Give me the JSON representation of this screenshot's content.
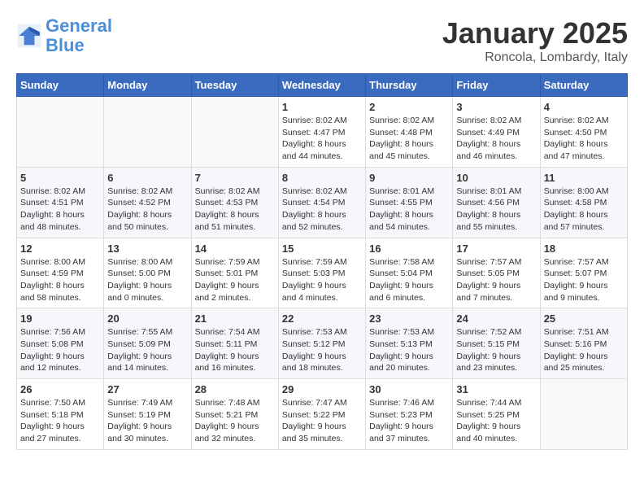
{
  "header": {
    "logo_general": "General",
    "logo_blue": "Blue",
    "month": "January 2025",
    "location": "Roncola, Lombardy, Italy"
  },
  "weekdays": [
    "Sunday",
    "Monday",
    "Tuesday",
    "Wednesday",
    "Thursday",
    "Friday",
    "Saturday"
  ],
  "weeks": [
    [
      {
        "day": "",
        "detail": ""
      },
      {
        "day": "",
        "detail": ""
      },
      {
        "day": "",
        "detail": ""
      },
      {
        "day": "1",
        "detail": "Sunrise: 8:02 AM\nSunset: 4:47 PM\nDaylight: 8 hours\nand 44 minutes."
      },
      {
        "day": "2",
        "detail": "Sunrise: 8:02 AM\nSunset: 4:48 PM\nDaylight: 8 hours\nand 45 minutes."
      },
      {
        "day": "3",
        "detail": "Sunrise: 8:02 AM\nSunset: 4:49 PM\nDaylight: 8 hours\nand 46 minutes."
      },
      {
        "day": "4",
        "detail": "Sunrise: 8:02 AM\nSunset: 4:50 PM\nDaylight: 8 hours\nand 47 minutes."
      }
    ],
    [
      {
        "day": "5",
        "detail": "Sunrise: 8:02 AM\nSunset: 4:51 PM\nDaylight: 8 hours\nand 48 minutes."
      },
      {
        "day": "6",
        "detail": "Sunrise: 8:02 AM\nSunset: 4:52 PM\nDaylight: 8 hours\nand 50 minutes."
      },
      {
        "day": "7",
        "detail": "Sunrise: 8:02 AM\nSunset: 4:53 PM\nDaylight: 8 hours\nand 51 minutes."
      },
      {
        "day": "8",
        "detail": "Sunrise: 8:02 AM\nSunset: 4:54 PM\nDaylight: 8 hours\nand 52 minutes."
      },
      {
        "day": "9",
        "detail": "Sunrise: 8:01 AM\nSunset: 4:55 PM\nDaylight: 8 hours\nand 54 minutes."
      },
      {
        "day": "10",
        "detail": "Sunrise: 8:01 AM\nSunset: 4:56 PM\nDaylight: 8 hours\nand 55 minutes."
      },
      {
        "day": "11",
        "detail": "Sunrise: 8:00 AM\nSunset: 4:58 PM\nDaylight: 8 hours\nand 57 minutes."
      }
    ],
    [
      {
        "day": "12",
        "detail": "Sunrise: 8:00 AM\nSunset: 4:59 PM\nDaylight: 8 hours\nand 58 minutes."
      },
      {
        "day": "13",
        "detail": "Sunrise: 8:00 AM\nSunset: 5:00 PM\nDaylight: 9 hours\nand 0 minutes."
      },
      {
        "day": "14",
        "detail": "Sunrise: 7:59 AM\nSunset: 5:01 PM\nDaylight: 9 hours\nand 2 minutes."
      },
      {
        "day": "15",
        "detail": "Sunrise: 7:59 AM\nSunset: 5:03 PM\nDaylight: 9 hours\nand 4 minutes."
      },
      {
        "day": "16",
        "detail": "Sunrise: 7:58 AM\nSunset: 5:04 PM\nDaylight: 9 hours\nand 6 minutes."
      },
      {
        "day": "17",
        "detail": "Sunrise: 7:57 AM\nSunset: 5:05 PM\nDaylight: 9 hours\nand 7 minutes."
      },
      {
        "day": "18",
        "detail": "Sunrise: 7:57 AM\nSunset: 5:07 PM\nDaylight: 9 hours\nand 9 minutes."
      }
    ],
    [
      {
        "day": "19",
        "detail": "Sunrise: 7:56 AM\nSunset: 5:08 PM\nDaylight: 9 hours\nand 12 minutes."
      },
      {
        "day": "20",
        "detail": "Sunrise: 7:55 AM\nSunset: 5:09 PM\nDaylight: 9 hours\nand 14 minutes."
      },
      {
        "day": "21",
        "detail": "Sunrise: 7:54 AM\nSunset: 5:11 PM\nDaylight: 9 hours\nand 16 minutes."
      },
      {
        "day": "22",
        "detail": "Sunrise: 7:53 AM\nSunset: 5:12 PM\nDaylight: 9 hours\nand 18 minutes."
      },
      {
        "day": "23",
        "detail": "Sunrise: 7:53 AM\nSunset: 5:13 PM\nDaylight: 9 hours\nand 20 minutes."
      },
      {
        "day": "24",
        "detail": "Sunrise: 7:52 AM\nSunset: 5:15 PM\nDaylight: 9 hours\nand 23 minutes."
      },
      {
        "day": "25",
        "detail": "Sunrise: 7:51 AM\nSunset: 5:16 PM\nDaylight: 9 hours\nand 25 minutes."
      }
    ],
    [
      {
        "day": "26",
        "detail": "Sunrise: 7:50 AM\nSunset: 5:18 PM\nDaylight: 9 hours\nand 27 minutes."
      },
      {
        "day": "27",
        "detail": "Sunrise: 7:49 AM\nSunset: 5:19 PM\nDaylight: 9 hours\nand 30 minutes."
      },
      {
        "day": "28",
        "detail": "Sunrise: 7:48 AM\nSunset: 5:21 PM\nDaylight: 9 hours\nand 32 minutes."
      },
      {
        "day": "29",
        "detail": "Sunrise: 7:47 AM\nSunset: 5:22 PM\nDaylight: 9 hours\nand 35 minutes."
      },
      {
        "day": "30",
        "detail": "Sunrise: 7:46 AM\nSunset: 5:23 PM\nDaylight: 9 hours\nand 37 minutes."
      },
      {
        "day": "31",
        "detail": "Sunrise: 7:44 AM\nSunset: 5:25 PM\nDaylight: 9 hours\nand 40 minutes."
      },
      {
        "day": "",
        "detail": ""
      }
    ]
  ]
}
